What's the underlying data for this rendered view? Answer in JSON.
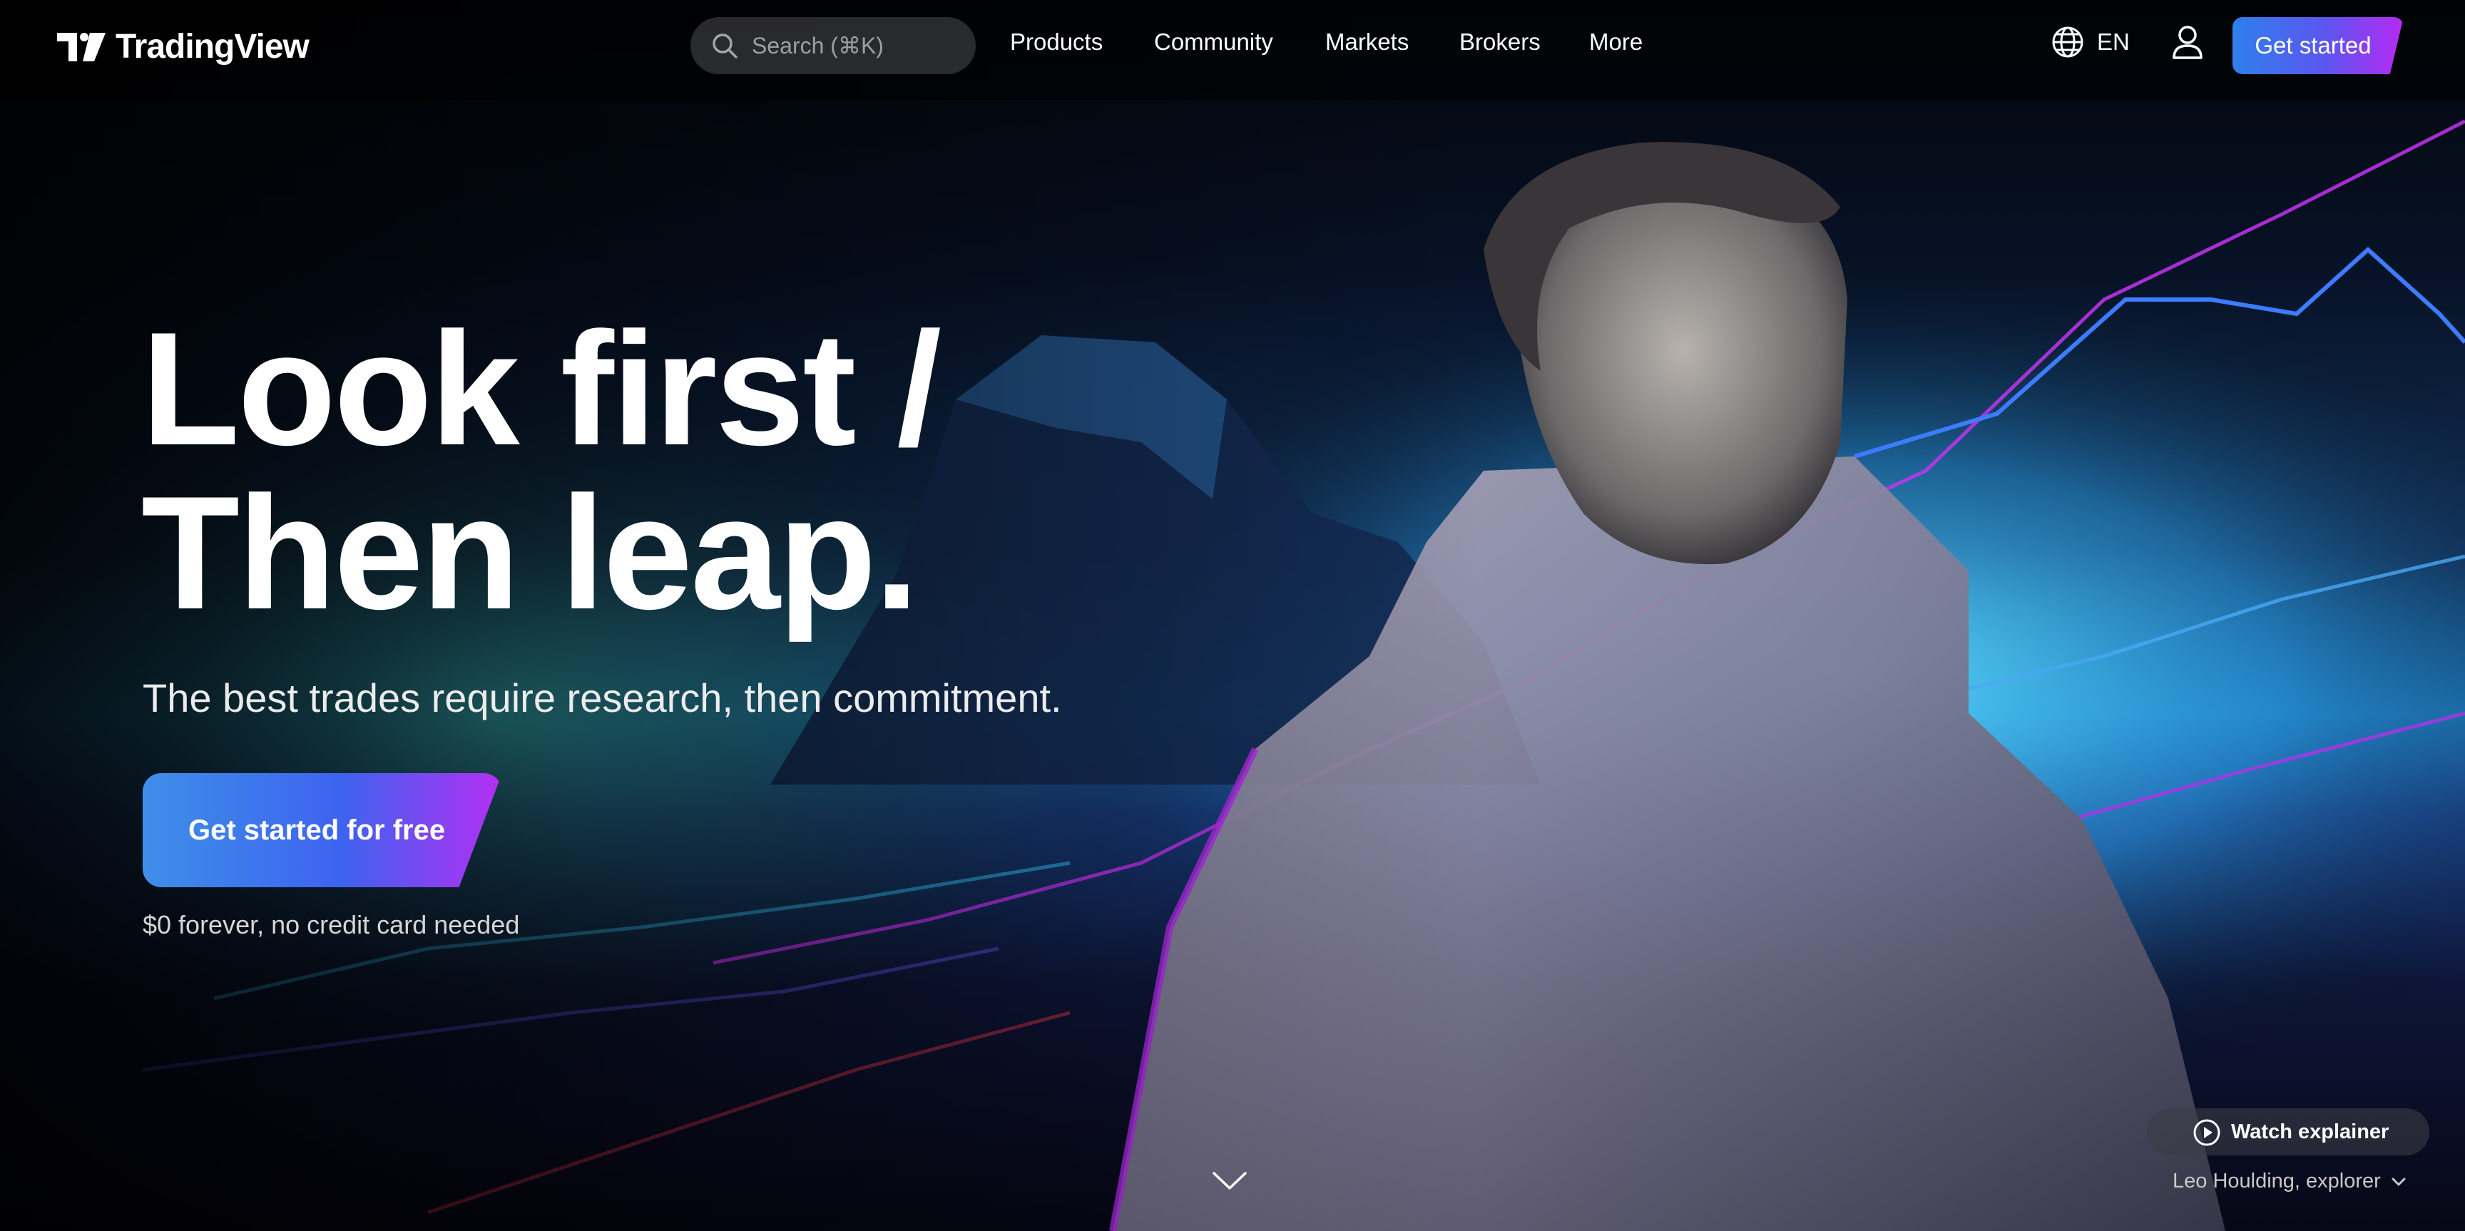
{
  "header": {
    "brand": "TradingView",
    "search_placeholder": "Search (⌘K)",
    "nav": [
      "Products",
      "Community",
      "Markets",
      "Brokers",
      "More"
    ],
    "language": "EN",
    "cta": "Get started"
  },
  "hero": {
    "headline_line1": "Look first /",
    "headline_line2": "Then leap.",
    "subheadline": "The best trades require research, then commitment.",
    "cta": "Get started for free",
    "note": "$0 forever, no credit card needed",
    "watch_label": "Watch explainer",
    "credit": "Leo Houlding, explorer"
  },
  "icons": {
    "logo": "tradingview-logo-icon",
    "search": "search-icon",
    "language": "globe-icon",
    "user": "user-icon",
    "play": "play-icon",
    "scroll": "chevron-down-icon",
    "credit_toggle": "chevron-down-icon"
  },
  "colors": {
    "background": "#000000",
    "accent_blue": "#2f80ed",
    "accent_purple": "#b72af3",
    "cyan_glow": "#4fd3f5"
  }
}
